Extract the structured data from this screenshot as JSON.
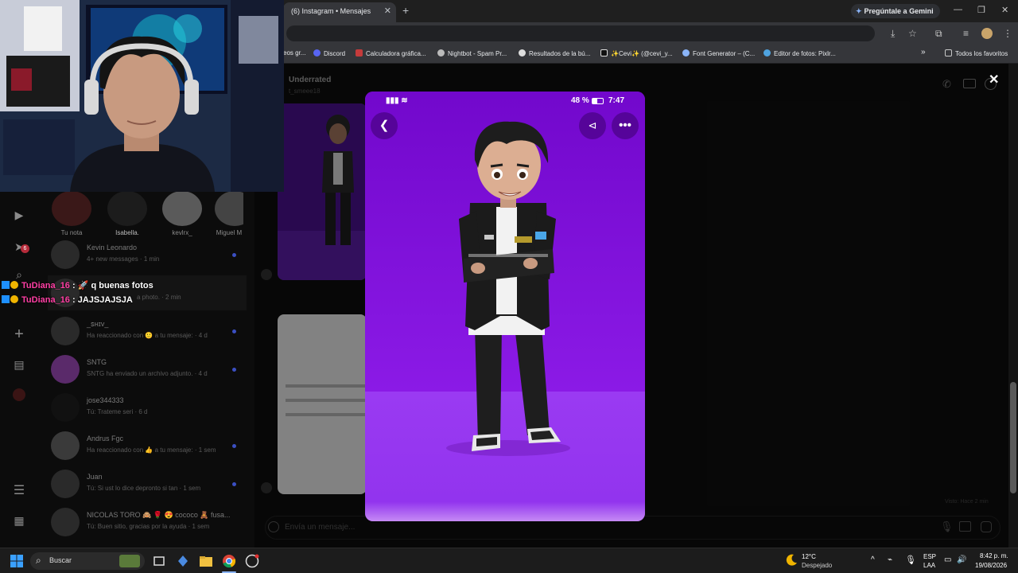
{
  "browser": {
    "tab_title": "(6) Instagram • Mensajes",
    "tab_close": "✕",
    "new_tab": "+",
    "gemini_button": "Pregúntale a Gemini",
    "window_controls": {
      "minimize": "—",
      "restore": "❐",
      "close": "✕"
    }
  },
  "bookmarks": {
    "items": [
      "eos gr...",
      "Discord",
      "Calculadora gráfica...",
      "Nightbot - Spam Pr...",
      "Resultados de la bú...",
      "✨Cevi✨ (@cevi_y...",
      "Font Generator – (C...",
      "Editor de fotos: Pixlr...",
      "Todos los favoritos"
    ],
    "overflow": "»"
  },
  "instagram": {
    "chat_header": {
      "name": "Underrated",
      "username": "t_smeee18"
    },
    "notes": [
      {
        "label": "Tu nota"
      },
      {
        "label": "Isabella."
      },
      {
        "label": "kevlrx_"
      },
      {
        "label": "Miguel M"
      }
    ],
    "conversations": [
      {
        "name": "Kevin Leonardo",
        "preview": "4+ new messages · 1 min",
        "unread": true
      },
      {
        "name": "",
        "preview": "a photo. · 2 min",
        "unread": false
      },
      {
        "name": "_ꜱʜɪᴠ_",
        "preview": "Ha reaccionado con 🙂 a tu mensaje: · 4 d",
        "unread": true
      },
      {
        "name": "SNTG",
        "preview": "SNTG ha enviado un archivo adjunto. · 4 d",
        "unread": true
      },
      {
        "name": "jose344333",
        "preview": "Tú: Trateme seri · 6 d",
        "unread": false
      },
      {
        "name": "Andrus Fgc",
        "preview": "Ha reaccionado con 👍 a tu mensaje: · 1 sem",
        "unread": true
      },
      {
        "name": "Juan",
        "preview": "Tú: Si ust lo dice depronto si tan · 1 sem",
        "unread": true
      },
      {
        "name": "NICOLAS TORO 🙈 🌹 😍 cococo 🧸 fusa...",
        "preview": "Tú: Buen sitio, gracias por la ayuda · 1 sem",
        "unread": false
      }
    ],
    "unread_badge": "6",
    "composer_placeholder": "Envía un mensaje...",
    "seen_text": "Visto: Hace 2 min",
    "close_viewer": "✕"
  },
  "chat_overlay": [
    {
      "user": "TuDiana_16",
      "message": " :  🚀 q buenas fotos"
    },
    {
      "user": "TuDiana_16",
      "message": " : JAJSJAJSJA"
    }
  ],
  "phone": {
    "battery": "48 %",
    "time": "7:47"
  },
  "taskbar": {
    "search_placeholder": "Buscar",
    "weather_temp": "12°C",
    "weather_desc": "Despejado",
    "lang": "ESP",
    "lang_sub": "LAA",
    "clock_time": "8:42 p. m.",
    "clock_date": "19/08/2026"
  },
  "colors": {
    "modal_purple_top": "#7d10d8",
    "modal_purple_floor": "#9a38f0",
    "chat_username": "#ff3fa4",
    "unread_dot": "#3b4fc2"
  }
}
